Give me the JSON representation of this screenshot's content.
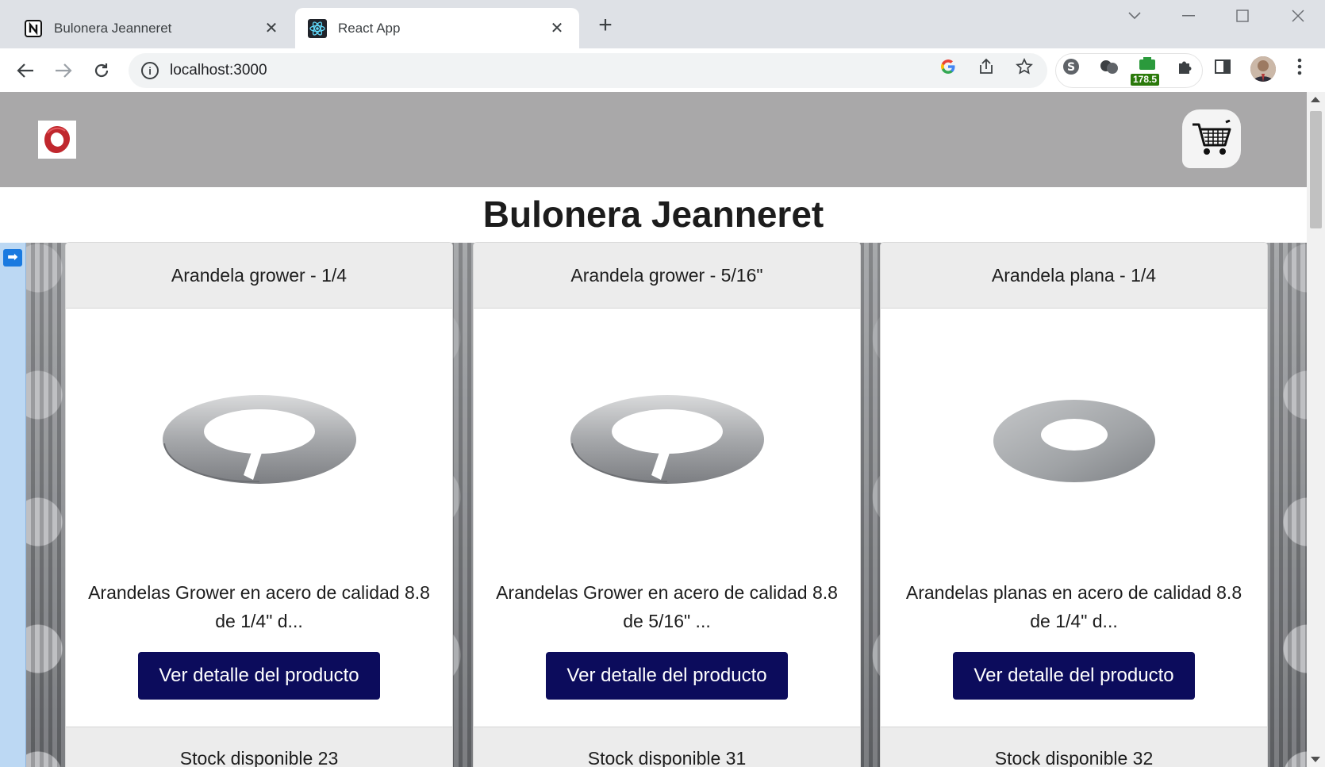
{
  "browser": {
    "tabs": [
      {
        "title": "Bulonera Jeanneret",
        "active": false,
        "icon": "notion-icon"
      },
      {
        "title": "React App",
        "active": true,
        "icon": "react-icon"
      }
    ],
    "address": "localhost:3000",
    "extension_badge": "178.5"
  },
  "site": {
    "title": "Bulonera Jeanneret",
    "brand_color": "#c0272d",
    "header_bg": "#a9a8a9",
    "button_bg": "#0c0c5c"
  },
  "products": [
    {
      "name": "Arandela grower - 1/4",
      "description": "Arandelas Grower en acero de calidad 8.8 de 1/4\" d...",
      "button": "Ver detalle del producto",
      "stock": "Stock disponible 23",
      "image": "split-lock-washer"
    },
    {
      "name": "Arandela grower - 5/16\"",
      "description": "Arandelas Grower en acero de calidad 8.8 de 5/16\" ...",
      "button": "Ver detalle del producto",
      "stock": "Stock disponible 31",
      "image": "split-lock-washer"
    },
    {
      "name": "Arandela plana - 1/4",
      "description": "Arandelas planas en acero de calidad 8.8 de 1/4\" d...",
      "button": "Ver detalle del producto",
      "stock": "Stock disponible 32",
      "image": "flat-washer"
    }
  ]
}
